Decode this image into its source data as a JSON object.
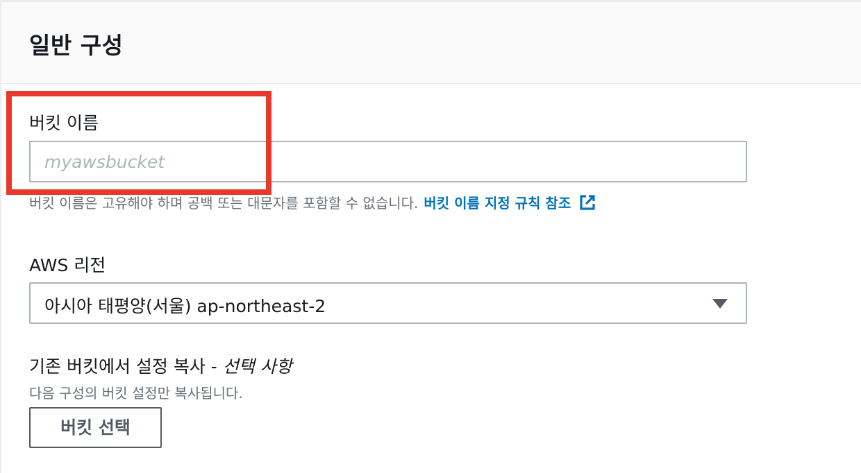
{
  "panel": {
    "title": "일반 구성"
  },
  "bucket_name": {
    "label": "버킷 이름",
    "placeholder": "myawsbucket",
    "value": "",
    "hint": "버킷 이름은 고유해야 하며 공백 또는 대문자를 포함할 수 없습니다.",
    "rules_link": "버킷 이름 지정 규칙 참조",
    "rules_link_icon": "external-link-icon"
  },
  "region": {
    "label": "AWS 리전",
    "selected": "아시아 태평양(서울) ap-northeast-2",
    "caret_icon": "caret-down-icon"
  },
  "copy_settings": {
    "label": "기존 버킷에서 설정 복사 -",
    "optional": "선택 사항",
    "description": "다음 구성의 버킷 설정만 복사됩니다.",
    "button_label": "버킷 선택"
  },
  "colors": {
    "link": "#0073bb",
    "highlight": "#e8392a",
    "border": "#aab7b8",
    "muted_text": "#687078",
    "header_bg": "#fafafa"
  }
}
